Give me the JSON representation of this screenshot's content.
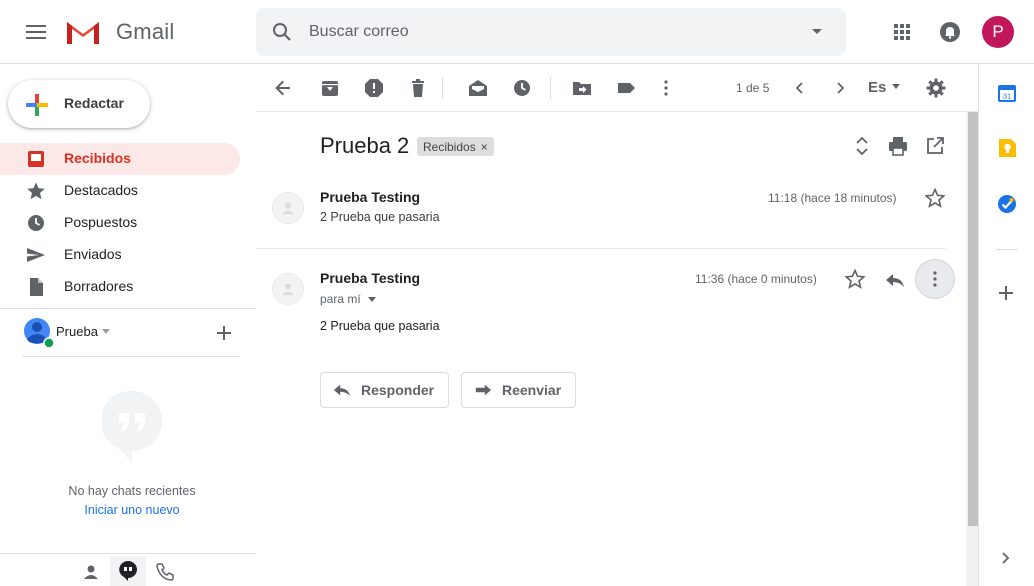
{
  "header": {
    "logo_text": "Gmail",
    "search_placeholder": "Buscar correo",
    "avatar_letter": "P"
  },
  "sidebar": {
    "compose_label": "Redactar",
    "items": [
      {
        "label": "Recibidos",
        "icon": "inbox-icon",
        "active": true
      },
      {
        "label": "Destacados",
        "icon": "star-icon",
        "active": false
      },
      {
        "label": "Pospuestos",
        "icon": "clock-icon",
        "active": false
      },
      {
        "label": "Enviados",
        "icon": "send-icon",
        "active": false
      },
      {
        "label": "Borradores",
        "icon": "file-icon",
        "active": false
      }
    ],
    "hangouts": {
      "user_name": "Prueba",
      "empty_text": "No hay chats recientes",
      "start_link": "Iniciar uno nuevo"
    }
  },
  "toolbar": {
    "page_count": "1 de 5",
    "language": "Es"
  },
  "thread": {
    "subject": "Prueba 2",
    "label": "Recibidos",
    "messages": [
      {
        "sender": "Prueba Testing",
        "snippet": "2 Prueba que pasaria",
        "time": "11:18 (hace 18 minutos)"
      },
      {
        "sender": "Prueba Testing",
        "to": "para mí",
        "body": "2 Prueba que pasaria",
        "time": "11:36 (hace 0 minutos)"
      }
    ],
    "reply_label": "Responder",
    "forward_label": "Reenviar"
  },
  "colors": {
    "accent_red": "#d93025",
    "active_bg": "#fce8e6",
    "link_blue": "#1a73e8",
    "avatar_bg": "#c2185b"
  }
}
